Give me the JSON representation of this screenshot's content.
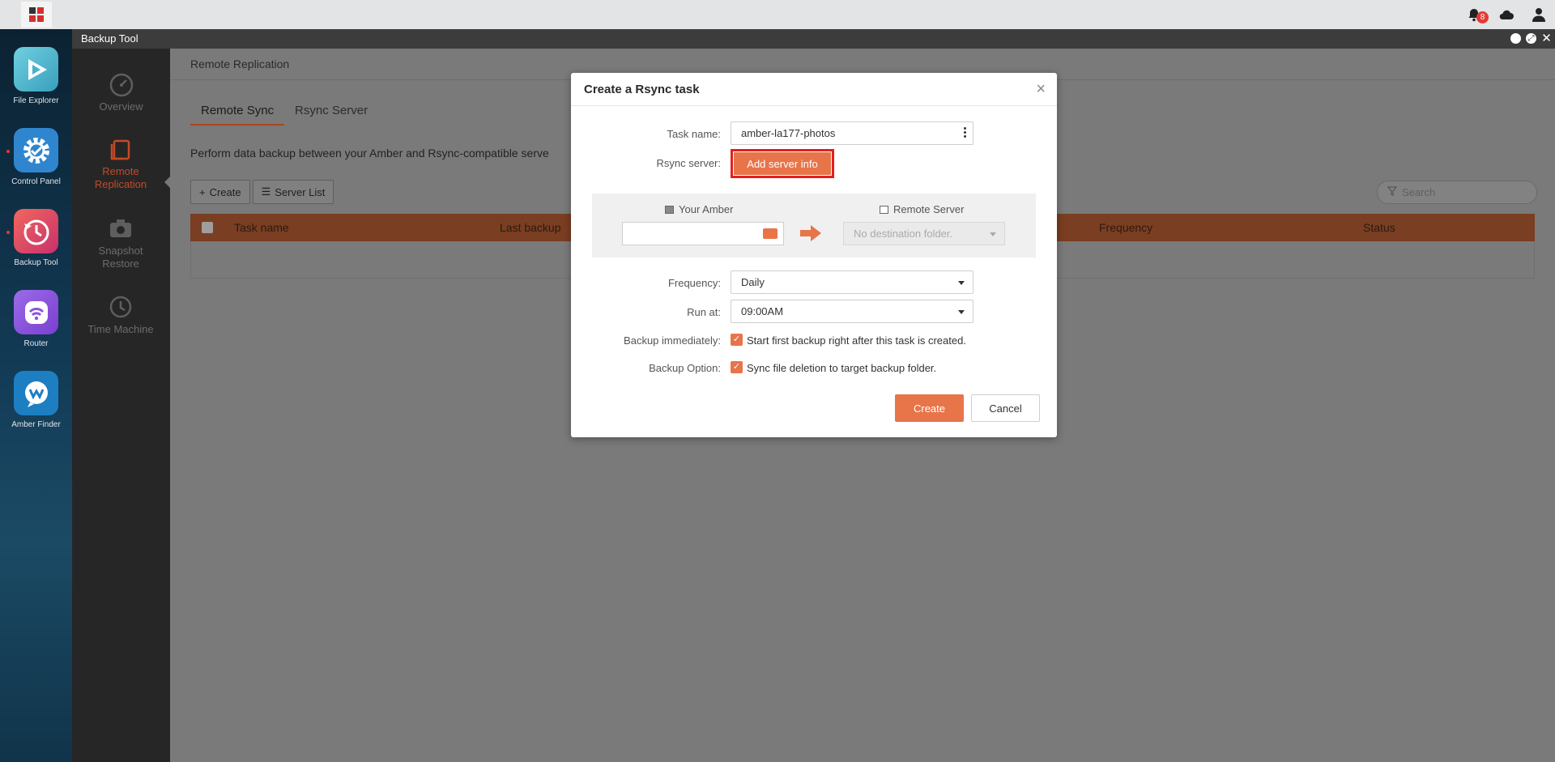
{
  "topbar": {
    "notification_count": "8"
  },
  "dock": {
    "items": [
      {
        "label": "File Explorer",
        "icon": "play-icon"
      },
      {
        "label": "Control Panel",
        "icon": "gear-icon"
      },
      {
        "label": "Backup Tool",
        "icon": "clock-icon"
      },
      {
        "label": "Router",
        "icon": "wifi-icon"
      },
      {
        "label": "Amber Finder",
        "icon": "finder-icon"
      }
    ]
  },
  "window": {
    "title": "Backup Tool"
  },
  "sidebar": {
    "items": [
      {
        "label": "Overview"
      },
      {
        "label": "Remote Replication"
      },
      {
        "label": "Snapshot Restore"
      },
      {
        "label": "Time Machine"
      }
    ]
  },
  "main": {
    "heading": "Remote Replication",
    "tabs": [
      {
        "label": "Remote Sync"
      },
      {
        "label": "Rsync Server"
      }
    ],
    "description": "Perform data backup between your Amber and Rsync-compatible serve",
    "toolbar": {
      "create_label": "Create",
      "server_list_label": "Server List"
    },
    "search_placeholder": "Search",
    "table": {
      "columns": [
        "Task name",
        "Last backup",
        "Frequency",
        "Status"
      ]
    }
  },
  "modal": {
    "title": "Create a Rsync task",
    "task_name_label": "Task name:",
    "task_name_value": "amber-la177-photos",
    "rsync_server_label": "Rsync server:",
    "add_server_label": "Add server info",
    "your_amber_label": "Your Amber",
    "remote_server_label": "Remote Server",
    "destination_placeholder": "No destination folder.",
    "frequency_label": "Frequency:",
    "frequency_value": "Daily",
    "run_at_label": "Run at:",
    "run_at_value": "09:00AM",
    "backup_immediately_label": "Backup immediately:",
    "backup_immediately_text": "Start first backup right after this task is created.",
    "backup_option_label": "Backup Option:",
    "backup_option_text": "Sync file deletion to target backup folder.",
    "create_label": "Create",
    "cancel_label": "Cancel"
  },
  "colors": {
    "accent": "#e8744a",
    "highlight_border": "#e41f1f"
  }
}
